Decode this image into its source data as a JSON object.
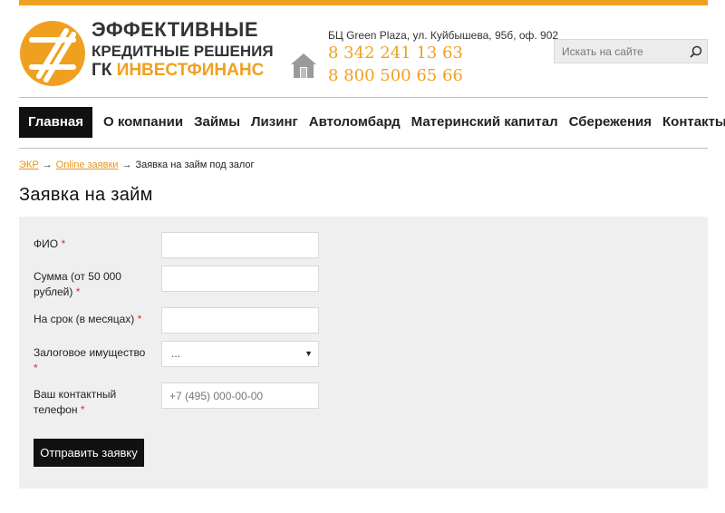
{
  "header": {
    "logo": {
      "line1": "ЭФФЕКТИВНЫЕ",
      "line2": "КРЕДИТНЫЕ РЕШЕНИЯ",
      "line3_prefix": "ГК ",
      "line3_accent": "ИНВЕСТФИНАНС"
    },
    "address": "БЦ Green Plaza, ул. Куйбышева, 95б, оф. 902",
    "phones": [
      "8 342 241 13 63",
      "8 800 500 65 66"
    ],
    "search": {
      "placeholder": "Искать на сайте",
      "icon": "search-icon"
    },
    "home_icon": "home-icon"
  },
  "nav": {
    "items": [
      {
        "label": "Главная",
        "active": true
      },
      {
        "label": "О компании"
      },
      {
        "label": "Займы"
      },
      {
        "label": "Лизинг"
      },
      {
        "label": "Автоломбард"
      },
      {
        "label": "Материнский капитал"
      },
      {
        "label": "Сбережения"
      },
      {
        "label": "Контакты"
      }
    ]
  },
  "breadcrumb": {
    "items": [
      "ЭКР",
      "Online заявки",
      "Заявка на займ под залог"
    ],
    "separator": "→"
  },
  "page": {
    "title": "Заявка на займ"
  },
  "form": {
    "required_mark": "*",
    "fields": [
      {
        "label": "ФИО",
        "value": "",
        "placeholder": ""
      },
      {
        "label": "Сумма (от 50 000 рублей)",
        "value": "",
        "placeholder": ""
      },
      {
        "label": "На срок (в месяцах)",
        "value": "",
        "placeholder": ""
      },
      {
        "label": "Залоговое имущество",
        "selected": "..."
      },
      {
        "label": "Ваш контактный телефон",
        "value": "",
        "placeholder": "+7 (495) 000-00-00"
      }
    ],
    "submit_label": "Отправить заявку"
  },
  "colors": {
    "accent": "#f0a020",
    "link": "#e8951a",
    "required": "#d9312b",
    "nav_active_bg": "#111111",
    "panel_bg": "#efefef"
  }
}
